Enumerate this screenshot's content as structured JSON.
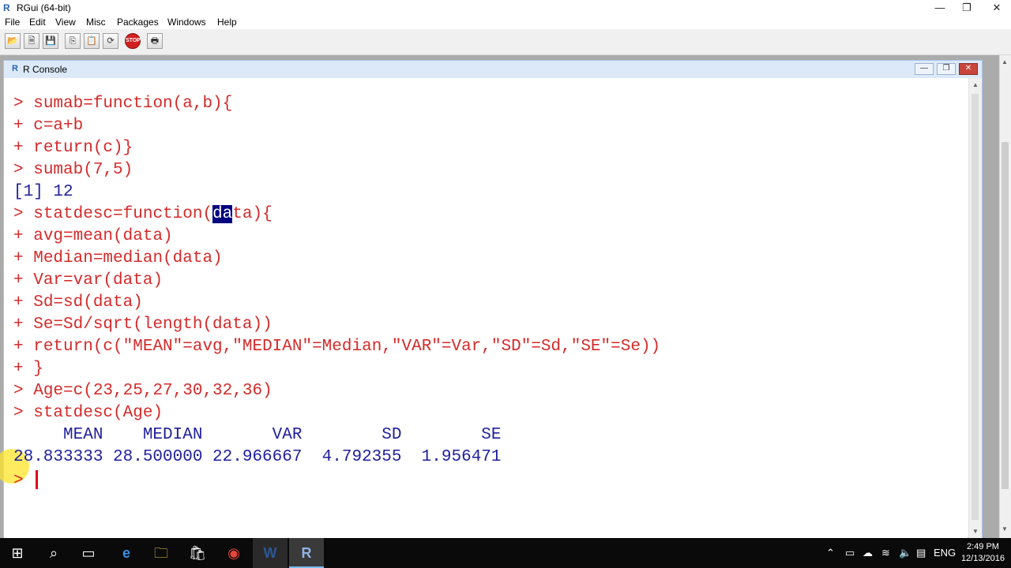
{
  "window": {
    "title": "RGui (64-bit)",
    "icon": "R",
    "controls": {
      "minimize": "—",
      "restore": "❐",
      "close": "✕"
    }
  },
  "menu": [
    "File",
    "Edit",
    "View",
    "Misc",
    "Packages",
    "Windows",
    "Help"
  ],
  "toolbar": {
    "buttons": [
      {
        "name": "open-script-button",
        "glyph": "📂"
      },
      {
        "name": "load-workspace-button",
        "glyph": "🗎"
      },
      {
        "name": "save-workspace-button",
        "glyph": "💾"
      },
      {
        "name": "copy-button",
        "glyph": "⎘"
      },
      {
        "name": "paste-button",
        "glyph": "📋"
      },
      {
        "name": "copy-paste-button",
        "glyph": "⟳"
      },
      {
        "name": "stop-button",
        "glyph": "STOP"
      },
      {
        "name": "print-button",
        "glyph": "🖶"
      }
    ]
  },
  "console": {
    "title": "R Console",
    "icon": "R",
    "controls": {
      "minimize": "—",
      "restore": "❐",
      "close": "✕"
    },
    "lines": [
      {
        "prompt": "> ",
        "code": "sumab=function(a,b){"
      },
      {
        "prompt": "+ ",
        "code": "c=a+b"
      },
      {
        "prompt": "+ ",
        "code": "return(c)}"
      },
      {
        "prompt": "> ",
        "code": "sumab(7,5)"
      },
      {
        "output": "[1] 12"
      },
      {
        "prompt": "> ",
        "code_before": "statdesc=function(",
        "code_selected": "da",
        "code_after": "ta){"
      },
      {
        "prompt": "+ ",
        "code": "avg=mean(data)"
      },
      {
        "prompt": "+ ",
        "code": "Median=median(data)"
      },
      {
        "prompt": "+ ",
        "code": "Var=var(data)"
      },
      {
        "prompt": "+ ",
        "code": "Sd=sd(data)"
      },
      {
        "prompt": "+ ",
        "code": "Se=Sd/sqrt(length(data))"
      },
      {
        "prompt": "+ ",
        "code": "return(c(\"MEAN\"=avg,\"MEDIAN\"=Median,\"VAR\"=Var,\"SD\"=Sd,\"SE\"=Se))"
      },
      {
        "prompt": "+ ",
        "code": "}"
      },
      {
        "prompt": "> ",
        "code": "Age=c(23,25,27,30,32,36)"
      },
      {
        "prompt": "> ",
        "code": "statdesc(Age)"
      },
      {
        "output": "     MEAN    MEDIAN       VAR        SD        SE"
      },
      {
        "output": "28.833333 28.500000 22.966667  4.792355  1.956471"
      }
    ],
    "input_prompt": "> "
  },
  "taskbar": {
    "apps": [
      {
        "name": "start-icon",
        "glyph": "⊞"
      },
      {
        "name": "search-icon",
        "glyph": "⌕"
      },
      {
        "name": "task-view-icon",
        "glyph": "▭"
      },
      {
        "name": "edge-icon",
        "glyph": "e"
      },
      {
        "name": "file-explorer-icon",
        "glyph": "🗀"
      },
      {
        "name": "store-icon",
        "glyph": "🛍"
      },
      {
        "name": "chrome-icon",
        "glyph": "◉"
      },
      {
        "name": "word-icon",
        "glyph": "W"
      },
      {
        "name": "rgui-taskbar-icon",
        "glyph": "R"
      }
    ],
    "tray": {
      "chevron": "⌃",
      "language": "ENG",
      "time": "2:49 PM",
      "date": "12/13/2016"
    }
  },
  "colors": {
    "input": "#d42a2a",
    "output": "#1f1f9c",
    "selection": "#000080",
    "cursor": "#e0001b"
  }
}
